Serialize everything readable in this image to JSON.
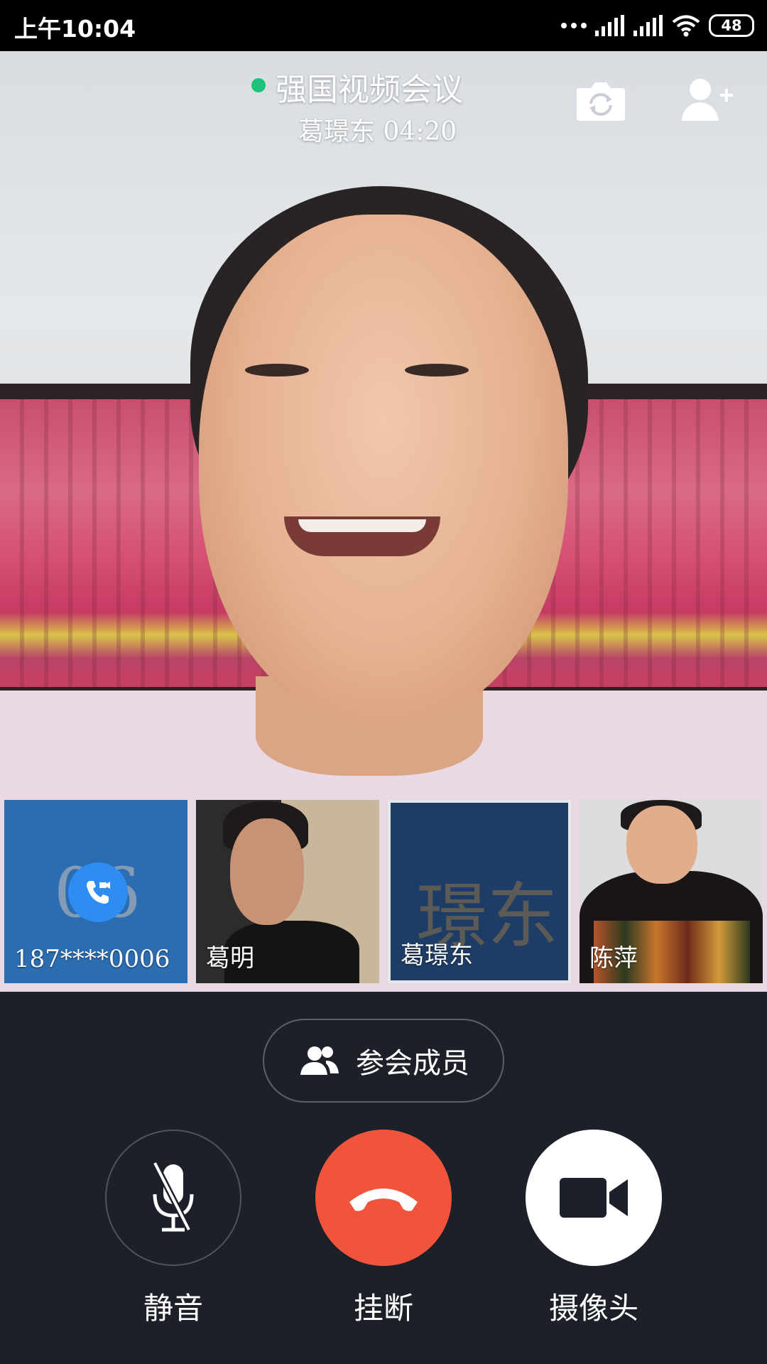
{
  "status_bar": {
    "time": "上午10:04",
    "battery": "48",
    "icons": [
      "more-dots-icon",
      "signal-icon",
      "signal-icon",
      "wifi-icon",
      "battery-icon"
    ]
  },
  "meeting": {
    "title": "强国视频会议",
    "subtitle": "葛璟东 04:20",
    "status_color": "#1ec179",
    "actions": [
      "flip-camera-icon",
      "add-person-icon"
    ]
  },
  "participants": [
    {
      "name": "187****0006",
      "placeholder": "06",
      "badge_icon": "video-call-icon"
    },
    {
      "name": "葛明"
    },
    {
      "name": "葛璟东",
      "placeholder": "璟东",
      "active": true
    },
    {
      "name": "陈萍"
    }
  ],
  "participants_button": {
    "label": "参会成员",
    "icon": "group-icon"
  },
  "controls": {
    "mute": {
      "label": "静音",
      "icon": "mic-off-icon",
      "state": "muted"
    },
    "hangup": {
      "label": "挂断",
      "icon": "hang-up-icon",
      "color": "#f0553c"
    },
    "camera": {
      "label": "摄像头",
      "icon": "video-camera-icon"
    }
  }
}
